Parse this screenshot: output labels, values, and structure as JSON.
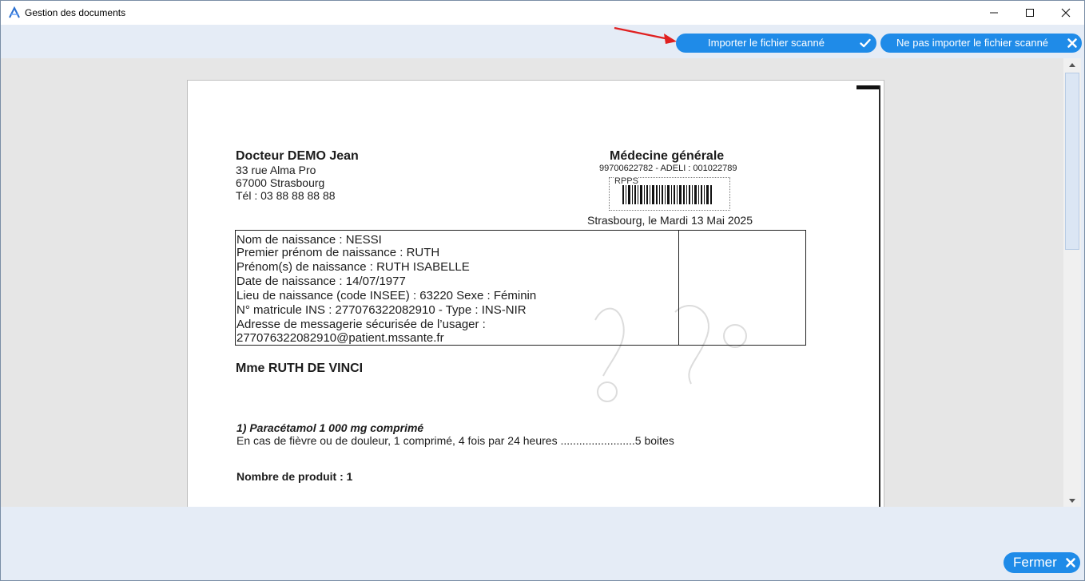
{
  "window": {
    "title": "Gestion des documents"
  },
  "toolbar": {
    "import_label": "Importer le fichier scanné",
    "no_import_label": "Ne pas importer le fichier scanné"
  },
  "document": {
    "doctor_name": "Docteur DEMO Jean",
    "address_line1": "33 rue Alma Pro",
    "address_line2": "67000 Strasbourg",
    "phone": "Tél : 03 88 88 88 88",
    "specialty": "Médecine générale",
    "ids": "99700622782 - ADELI : 001022789",
    "barcode_label": "RPPS",
    "date_line": "Strasbourg, le Mardi 13 Mai 2025",
    "patient_box": [
      "Nom de naissance : NESSI",
      "Premier prénom de naissance : RUTH",
      "Prénom(s) de naissance  : RUTH ISABELLE",
      "Date de naissance : 14/07/1977",
      "Lieu de naissance (code INSEE) : 63220 Sexe : Féminin",
      "N° matricule INS : 277076322082910 - Type : INS-NIR",
      "Adresse de messagerie sécurisée de l’usager :",
      "277076322082910@patient.mssante.fr"
    ],
    "patient_name": "Mme RUTH DE VINCI",
    "med_title": "1)  Paracétamol 1 000 mg comprimé",
    "med_line": "En cas de fièvre ou de douleur, 1 comprimé,  4 fois par 24 heures ........................5 boites",
    "product_count": "Nombre de produit : 1"
  },
  "footer": {
    "close_label": "Fermer"
  },
  "colors": {
    "accent": "#1f8be8",
    "window_bg": "#e5ecf6",
    "annotation_arrow": "#e02020"
  },
  "icons": {
    "import": "check-icon",
    "no_import": "close-icon",
    "close": "close-icon",
    "app": "app-logo-icon"
  }
}
